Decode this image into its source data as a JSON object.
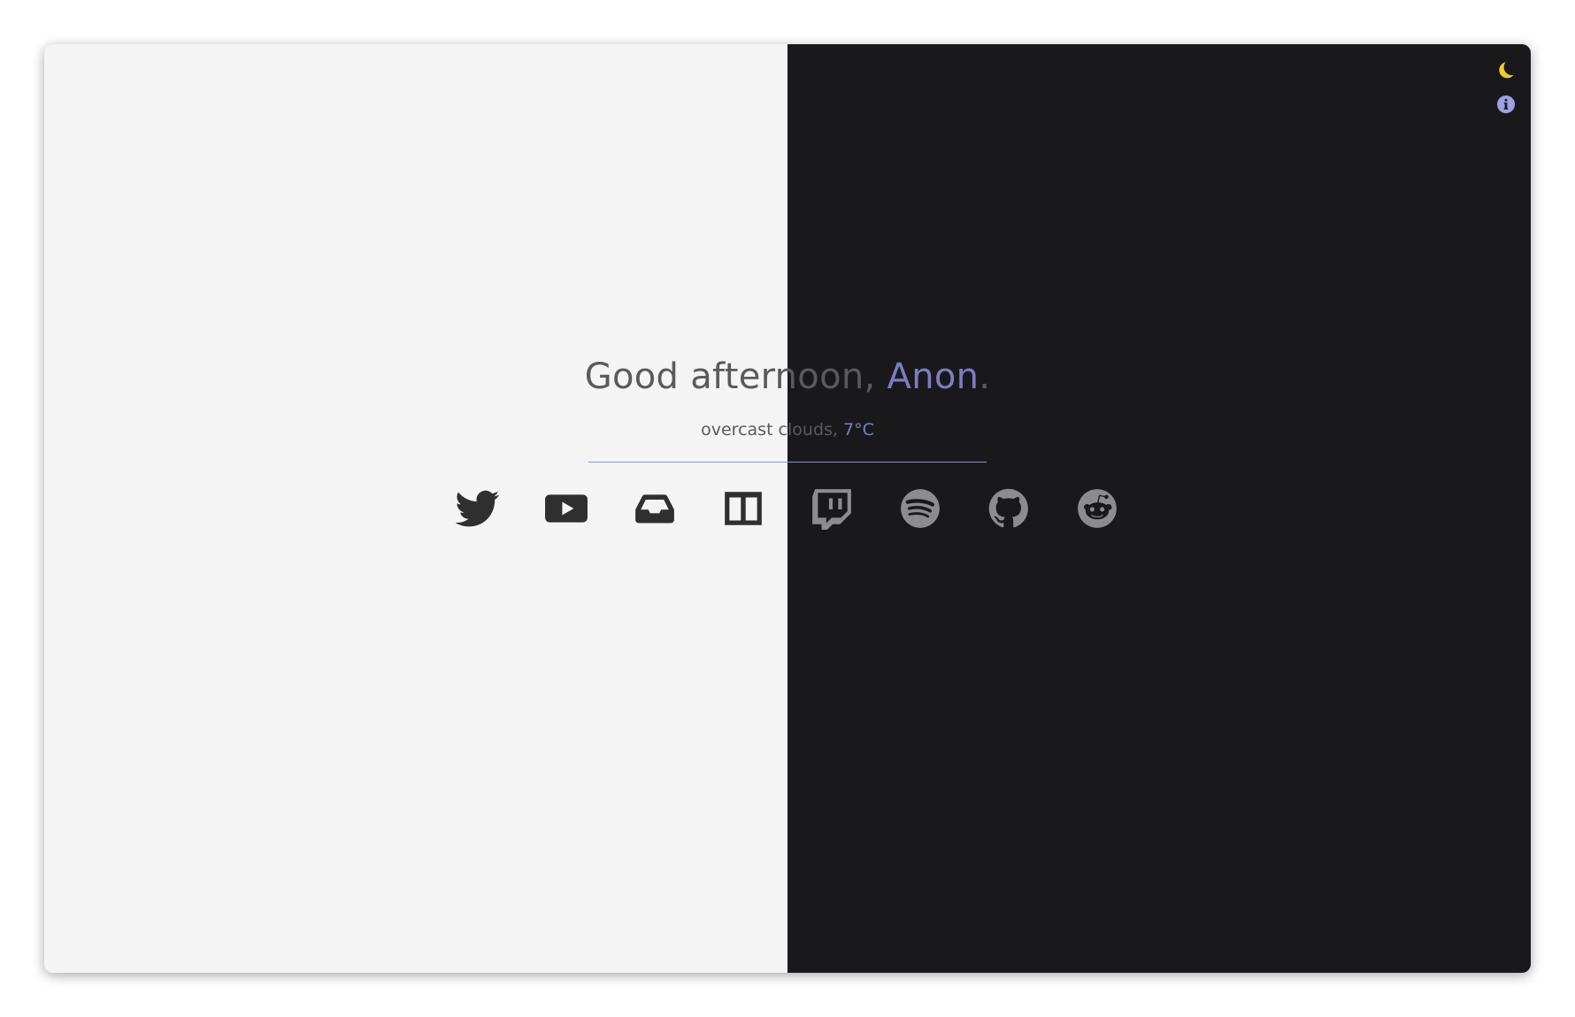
{
  "greeting": {
    "text": "Good afternoon, ",
    "name": "Anon",
    "punctuation": "."
  },
  "weather": {
    "description": "overcast clouds, ",
    "temperature": "7°C"
  },
  "links": [
    {
      "name": "twitter",
      "icon": "twitter-icon"
    },
    {
      "name": "youtube",
      "icon": "youtube-icon"
    },
    {
      "name": "inbox",
      "icon": "inbox-icon"
    },
    {
      "name": "columns",
      "icon": "columns-icon"
    },
    {
      "name": "twitch",
      "icon": "twitch-icon"
    },
    {
      "name": "spotify",
      "icon": "spotify-icon"
    },
    {
      "name": "github",
      "icon": "github-icon"
    },
    {
      "name": "reddit",
      "icon": "reddit-icon"
    }
  ],
  "top_icons": [
    "moon-icon",
    "info-icon"
  ],
  "colors": {
    "light_bg": "#f4f4f4",
    "dark_bg": "#19191b",
    "accent": "#7b7dc4",
    "text": "#5a5a5a",
    "moon": "#f2cb2e",
    "info": "#9fa0e4"
  }
}
